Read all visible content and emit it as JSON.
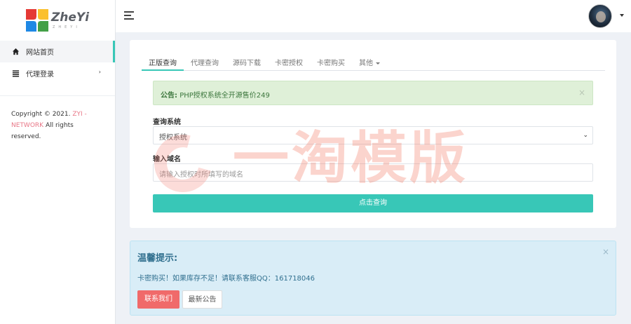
{
  "logo": {
    "title": "ZheYi",
    "subtitle": "ZHEYI"
  },
  "sidebar": {
    "items": [
      {
        "label": "网站首页",
        "icon": "home-icon",
        "active": true
      },
      {
        "label": "代理登录",
        "icon": "list-icon",
        "has_arrow": true
      }
    ],
    "copyright_prefix": "Copyright © 2021.",
    "copyright_brand": "ZYI - NETWORK",
    "copyright_suffix": "All rights reserved."
  },
  "tabs": [
    {
      "label": "正版查询",
      "active": true
    },
    {
      "label": "代理查询"
    },
    {
      "label": "源码下载"
    },
    {
      "label": "卡密授权"
    },
    {
      "label": "卡密购买"
    },
    {
      "label": "其他",
      "dropdown": true
    }
  ],
  "notice": {
    "prefix": "公告:",
    "text": "PHP授权系统全开源售价249",
    "close": "×"
  },
  "form": {
    "system_label": "查询系统",
    "system_value": "授权系统",
    "domain_label": "输入域名",
    "domain_placeholder": "请输入授权时所填写的域名",
    "submit_label": "点击查询"
  },
  "watermark": {
    "text": "一淘模版"
  },
  "tips": {
    "title": "温馨提示:",
    "text": "卡密购买！如果库存不足！请联系客服QQ：161718046",
    "close": "×",
    "contact_label": "联系我们",
    "news_label": "最新公告"
  },
  "colors": {
    "accent": "#38c7b7",
    "danger": "#f06a6a",
    "info_bg": "#d9edf7",
    "success_bg": "#dff0d8",
    "brand_pink": "#e87787"
  }
}
